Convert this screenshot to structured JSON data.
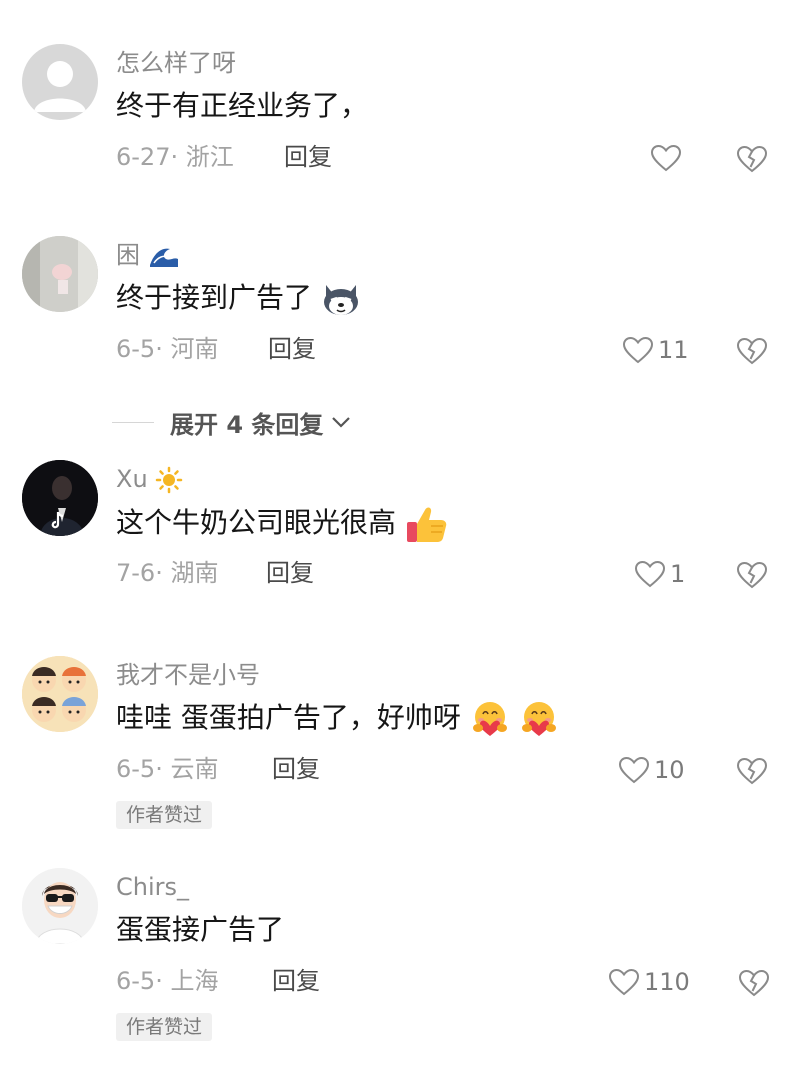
{
  "comments": [
    {
      "username": "怎么样了呀",
      "text": "终于有正经业务了，",
      "date": "6-27",
      "location": "浙江",
      "reply_label": "回复",
      "likes": ""
    },
    {
      "username": "困",
      "username_emoji": "wave-icon",
      "text": "终于接到广告了",
      "text_emoji": "husky-dog-emoji",
      "date": "6-5",
      "location": "河南",
      "reply_label": "回复",
      "likes": "11"
    },
    {
      "username": "Xu",
      "username_emoji": "sun-icon",
      "text": "这个牛奶公司眼光很高",
      "text_emoji": "thumbs-up-emoji",
      "date": "7-6",
      "location": "湖南",
      "reply_label": "回复",
      "likes": "1"
    },
    {
      "username": "我才不是小号",
      "text": "哇哇 蛋蛋拍广告了，好帅呀",
      "text_emoji": "hugging-face-emoji",
      "date": "6-5",
      "location": "云南",
      "reply_label": "回复",
      "likes": "10",
      "badge": "作者赞过"
    },
    {
      "username": "Chirs_",
      "text": "蛋蛋接广告了",
      "date": "6-5",
      "location": "上海",
      "reply_label": "回复",
      "likes": "110",
      "badge": "作者赞过"
    }
  ],
  "expand_replies": {
    "label": "展开 4 条回复"
  },
  "colors": {
    "username": "#8c8c8c",
    "meta": "#a3a3a3",
    "icon": "#8a8a8a"
  }
}
